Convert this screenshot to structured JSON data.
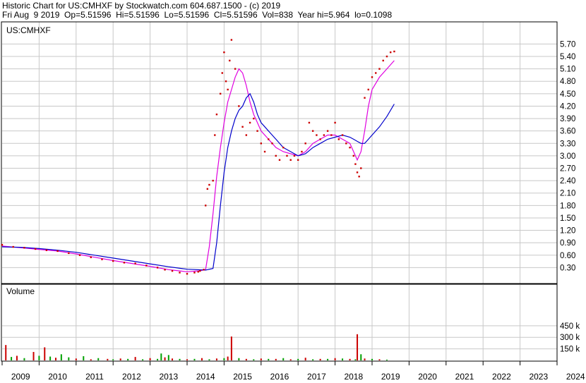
{
  "header": {
    "title": "Historic Chart for US:CMHXF by Stockwatch.com 604.687.1500 - (c) 2019",
    "quote_line": "Fri Aug  9 2019  Op=5.51596  Hi=5.51596  Lo=5.51596  Cl=5.51596  Vol=838  Year hi=5.964  lo=0.1098"
  },
  "chart_data": [
    {
      "type": "line",
      "title": "US:CMHXF",
      "x_tick_labels": [
        "2009",
        "2010",
        "2011",
        "2012",
        "2013",
        "2014",
        "2015",
        "2016",
        "2017",
        "2018",
        "2019",
        "2020",
        "2021",
        "2022",
        "2023",
        "2024"
      ],
      "y_tick_labels": [
        "5.70",
        "5.40",
        "5.10",
        "4.80",
        "4.50",
        "4.20",
        "3.90",
        "3.60",
        "3.30",
        "3.00",
        "2.70",
        "2.40",
        "2.10",
        "1.80",
        "1.50",
        "1.20",
        "0.90",
        "0.60",
        "0.30"
      ],
      "ylim": [
        0,
        6.0
      ],
      "grid": true,
      "colors": {
        "price": "#cc0000",
        "ma_short": "#e000e0",
        "ma_long": "#0000cc",
        "grid": "#c8c8c8"
      },
      "series": [
        {
          "role": "price",
          "x": [
            2009.0,
            2009.3,
            2009.6,
            2009.9,
            2010.2,
            2010.5,
            2010.8,
            2011.1,
            2011.4,
            2011.7,
            2012.0,
            2012.3,
            2012.6,
            2012.9,
            2013.2,
            2013.4,
            2013.6,
            2013.8,
            2014.0,
            2014.2,
            2014.3,
            2014.35,
            2014.45,
            2014.5,
            2014.55,
            2014.6,
            2014.7,
            2014.75,
            2014.8,
            2014.9,
            2014.95,
            2015.0,
            2015.05,
            2015.1,
            2015.15,
            2015.2,
            2015.3,
            2015.4,
            2015.5,
            2015.6,
            2015.7,
            2015.8,
            2015.9,
            2016.0,
            2016.1,
            2016.2,
            2016.3,
            2016.4,
            2016.5,
            2016.6,
            2016.7,
            2016.8,
            2016.9,
            2017.0,
            2017.1,
            2017.2,
            2017.3,
            2017.4,
            2017.5,
            2017.6,
            2017.7,
            2017.8,
            2017.9,
            2018.0,
            2018.1,
            2018.2,
            2018.3,
            2018.4,
            2018.5,
            2018.55,
            2018.6,
            2018.65,
            2018.7,
            2018.8,
            2018.9,
            2019.0,
            2019.1,
            2019.2,
            2019.3,
            2019.4,
            2019.5,
            2019.6
          ],
          "y": [
            0.85,
            0.8,
            0.78,
            0.75,
            0.72,
            0.7,
            0.65,
            0.6,
            0.55,
            0.5,
            0.46,
            0.42,
            0.4,
            0.35,
            0.3,
            0.25,
            0.22,
            0.18,
            0.15,
            0.18,
            0.2,
            0.22,
            0.25,
            1.8,
            2.2,
            2.3,
            2.4,
            3.5,
            4.0,
            4.5,
            5.0,
            5.5,
            4.8,
            4.6,
            5.3,
            5.8,
            5.1,
            4.2,
            3.7,
            3.5,
            3.8,
            3.9,
            3.6,
            3.3,
            3.1,
            3.4,
            3.3,
            3.0,
            2.9,
            3.2,
            3.0,
            2.9,
            3.0,
            2.9,
            3.1,
            3.3,
            3.8,
            3.6,
            3.5,
            3.4,
            3.5,
            3.6,
            3.5,
            3.8,
            3.4,
            3.5,
            3.3,
            3.2,
            3.0,
            2.8,
            2.6,
            2.5,
            2.7,
            4.4,
            4.6,
            4.9,
            5.0,
            5.1,
            5.3,
            5.4,
            5.5,
            5.52
          ]
        },
        {
          "role": "ma_short",
          "x": [
            2009.0,
            2009.5,
            2010.0,
            2010.5,
            2011.0,
            2011.5,
            2012.0,
            2012.5,
            2013.0,
            2013.5,
            2014.0,
            2014.3,
            2014.5,
            2014.6,
            2014.7,
            2014.8,
            2014.9,
            2015.0,
            2015.1,
            2015.2,
            2015.3,
            2015.4,
            2015.5,
            2015.6,
            2015.7,
            2015.8,
            2015.9,
            2016.0,
            2016.2,
            2016.4,
            2016.6,
            2016.8,
            2017.0,
            2017.2,
            2017.4,
            2017.6,
            2017.8,
            2018.0,
            2018.2,
            2018.4,
            2018.5,
            2018.6,
            2018.7,
            2018.8,
            2018.9,
            2019.0,
            2019.2,
            2019.4,
            2019.6
          ],
          "y": [
            0.82,
            0.78,
            0.74,
            0.7,
            0.63,
            0.55,
            0.47,
            0.4,
            0.33,
            0.25,
            0.2,
            0.22,
            0.25,
            0.8,
            1.6,
            2.5,
            3.2,
            3.8,
            4.3,
            4.6,
            4.9,
            5.1,
            5.0,
            4.7,
            4.3,
            4.0,
            3.8,
            3.6,
            3.4,
            3.2,
            3.1,
            3.05,
            3.0,
            3.1,
            3.3,
            3.4,
            3.5,
            3.5,
            3.4,
            3.3,
            3.1,
            2.9,
            3.1,
            3.6,
            4.2,
            4.6,
            4.9,
            5.1,
            5.3
          ]
        },
        {
          "role": "ma_long",
          "x": [
            2009.0,
            2009.5,
            2010.0,
            2010.5,
            2011.0,
            2011.5,
            2012.0,
            2012.5,
            2013.0,
            2013.5,
            2014.0,
            2014.5,
            2014.7,
            2014.8,
            2014.9,
            2015.0,
            2015.1,
            2015.2,
            2015.3,
            2015.4,
            2015.5,
            2015.6,
            2015.7,
            2015.8,
            2015.9,
            2016.0,
            2016.2,
            2016.4,
            2016.6,
            2016.8,
            2017.0,
            2017.2,
            2017.4,
            2017.6,
            2017.8,
            2018.0,
            2018.2,
            2018.4,
            2018.5,
            2018.6,
            2018.7,
            2018.8,
            2018.9,
            2019.0,
            2019.2,
            2019.4,
            2019.6
          ],
          "y": [
            0.8,
            0.79,
            0.76,
            0.72,
            0.67,
            0.6,
            0.53,
            0.46,
            0.39,
            0.32,
            0.26,
            0.24,
            0.28,
            0.9,
            1.8,
            2.6,
            3.2,
            3.6,
            3.9,
            4.1,
            4.2,
            4.4,
            4.5,
            4.3,
            4.0,
            3.8,
            3.6,
            3.4,
            3.2,
            3.1,
            3.0,
            3.05,
            3.2,
            3.3,
            3.4,
            3.45,
            3.5,
            3.45,
            3.4,
            3.35,
            3.3,
            3.3,
            3.4,
            3.5,
            3.7,
            3.95,
            4.25
          ]
        }
      ]
    },
    {
      "type": "bar",
      "title": "Volume",
      "y_tick_labels": [
        "450 k",
        "300 k",
        "150 k"
      ],
      "ylim": [
        0,
        540
      ],
      "grid": true,
      "colors": {
        "up": "#00a000",
        "down": "#cc0000"
      },
      "x": [
        2009.1,
        2009.25,
        2009.4,
        2009.6,
        2009.85,
        2010.0,
        2010.15,
        2010.3,
        2010.45,
        2010.6,
        2010.8,
        2011.0,
        2011.2,
        2011.4,
        2011.6,
        2011.85,
        2012.0,
        2012.2,
        2012.4,
        2012.6,
        2012.8,
        2013.0,
        2013.2,
        2013.3,
        2013.4,
        2013.5,
        2013.6,
        2013.8,
        2014.0,
        2014.2,
        2014.4,
        2014.6,
        2014.8,
        2015.0,
        2015.1,
        2015.2,
        2015.4,
        2015.6,
        2015.8,
        2016.0,
        2016.2,
        2016.4,
        2016.6,
        2016.8,
        2017.0,
        2017.2,
        2017.4,
        2017.6,
        2017.8,
        2018.0,
        2018.2,
        2018.4,
        2018.55,
        2018.6,
        2018.7,
        2018.8,
        2019.0,
        2019.2,
        2019.4
      ],
      "values": [
        200,
        45,
        60,
        30,
        110,
        60,
        170,
        50,
        35,
        80,
        40,
        25,
        55,
        15,
        30,
        20,
        15,
        25,
        20,
        45,
        15,
        30,
        20,
        90,
        40,
        70,
        25,
        20,
        15,
        20,
        30,
        15,
        25,
        30,
        50,
        310,
        30,
        20,
        15,
        25,
        20,
        20,
        30,
        15,
        20,
        35,
        15,
        20,
        20,
        30,
        25,
        20,
        15,
        340,
        80,
        25,
        20,
        15,
        10
      ],
      "up": [
        false,
        true,
        false,
        true,
        false,
        true,
        false,
        true,
        false,
        true,
        true,
        false,
        true,
        false,
        true,
        false,
        true,
        false,
        true,
        false,
        true,
        false,
        true,
        true,
        false,
        true,
        false,
        true,
        false,
        true,
        false,
        true,
        false,
        true,
        false,
        false,
        true,
        false,
        true,
        false,
        true,
        false,
        true,
        false,
        true,
        false,
        true,
        false,
        true,
        false,
        true,
        false,
        true,
        false,
        true,
        false,
        true,
        false,
        true
      ]
    }
  ]
}
